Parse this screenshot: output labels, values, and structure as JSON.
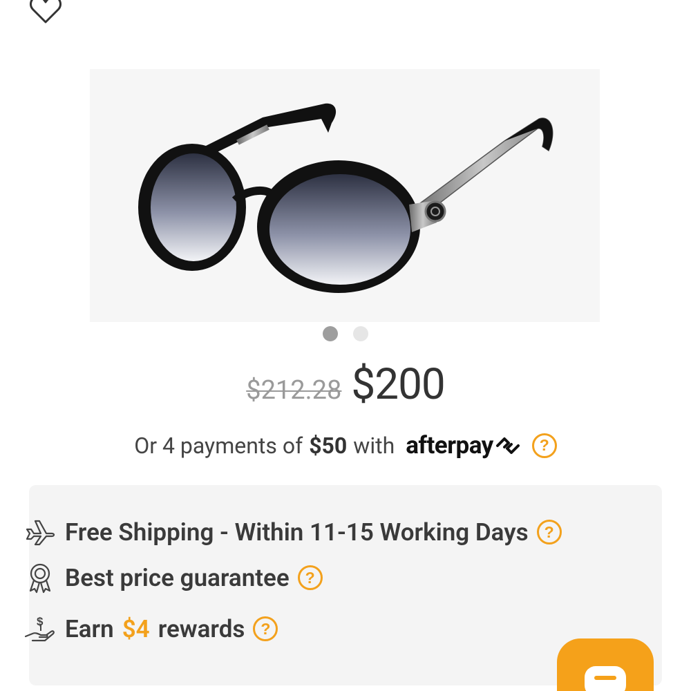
{
  "product": {
    "image_count": 2,
    "active_image_index": 0,
    "price_original": "$212.28",
    "price_current": "$200"
  },
  "afterpay": {
    "prefix": "Or 4 payments of",
    "amount": "$50",
    "suffix": "with",
    "logo_text": "afterpay"
  },
  "features": {
    "shipping": "Free Shipping - Within 11-15 Working Days",
    "price_guarantee": "Best price guarantee",
    "rewards_prefix": "Earn",
    "rewards_amount": "$4",
    "rewards_suffix": "rewards"
  },
  "help_symbol": "?",
  "icons": {
    "wishlist": "heart-outline-icon",
    "shipping": "airplane-icon",
    "guarantee": "award-ribbon-icon",
    "rewards": "hand-money-icon",
    "chat": "chat-bubble-icon"
  },
  "colors": {
    "accent": "#f3a11c",
    "text": "#333333",
    "muted": "#9a9a9a",
    "panel": "#f4f4f4"
  }
}
